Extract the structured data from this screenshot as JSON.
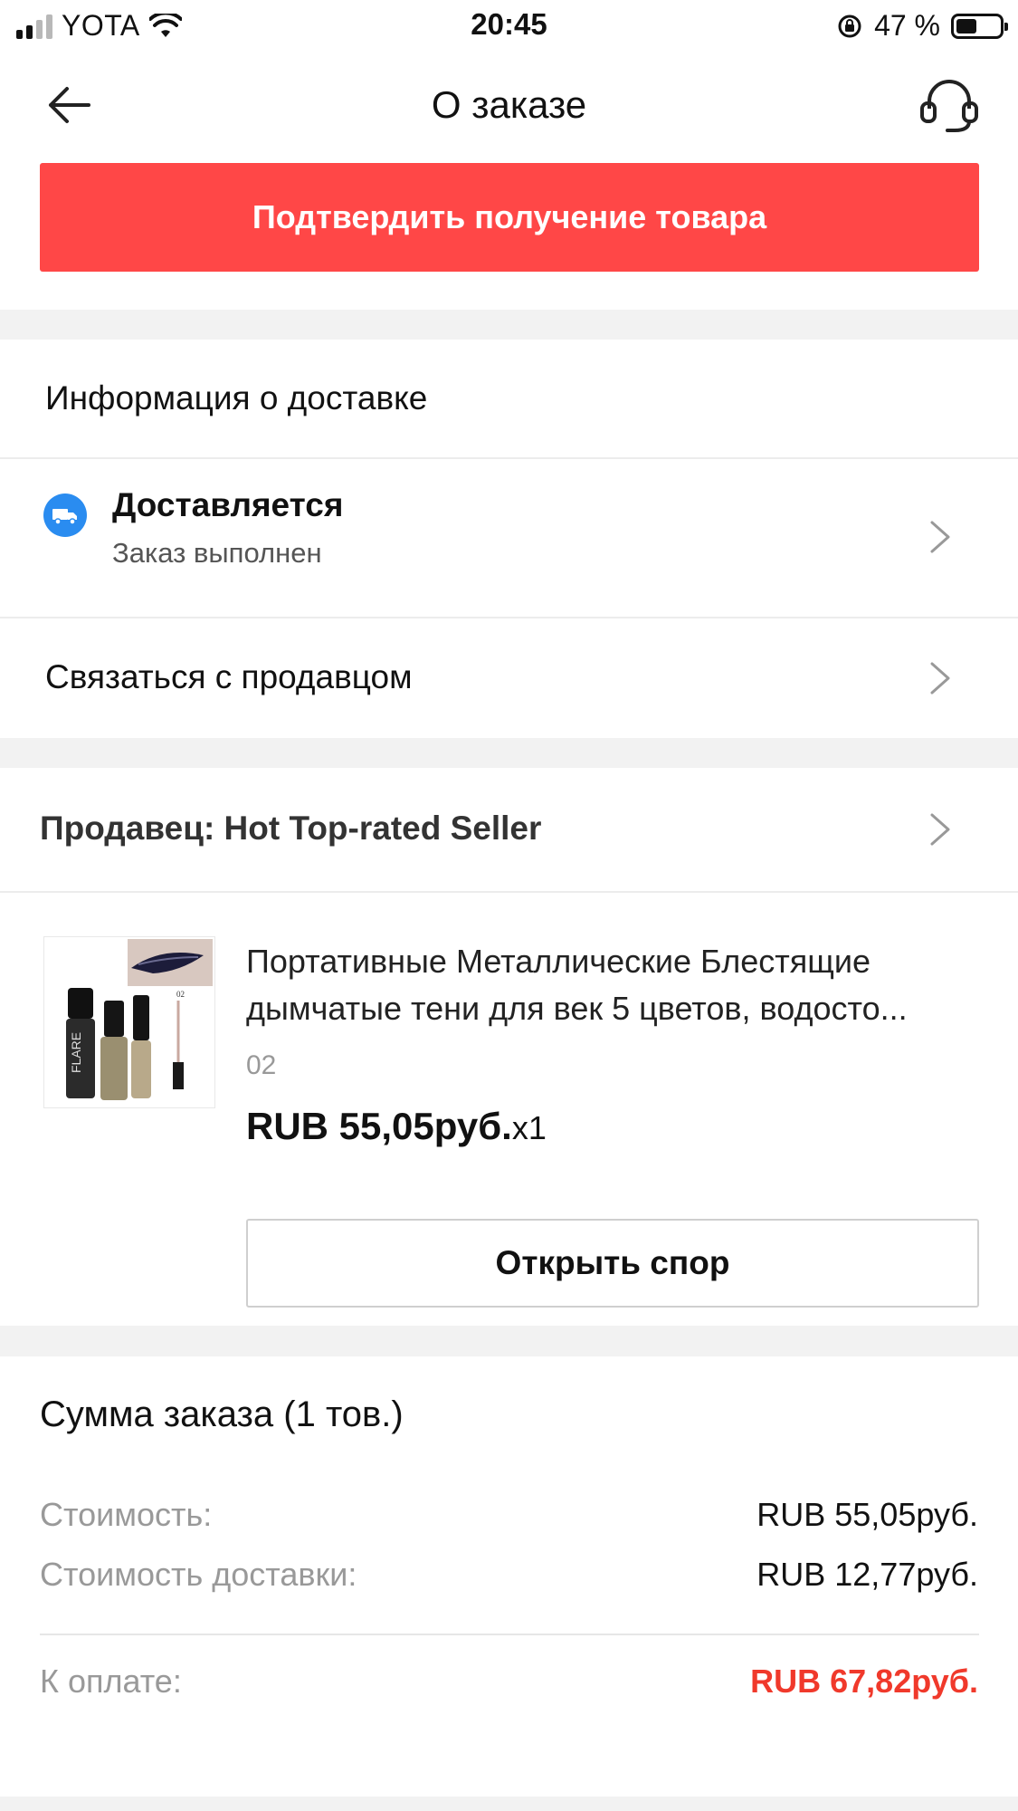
{
  "status_bar": {
    "carrier": "YOTA",
    "time": "20:45",
    "battery": "47 %",
    "battery_level": 0.47
  },
  "header": {
    "title": "О заказе"
  },
  "confirm": {
    "label": "Подтвердить получение товара",
    "color": "#ff4747"
  },
  "delivery": {
    "heading": "Информация о доставке",
    "status_title": "Доставляется",
    "status_subtitle": "Заказ выполнен",
    "contact_seller": "Связаться с продавцом"
  },
  "seller": {
    "label": "Продавец: Hot Top-rated Seller"
  },
  "product": {
    "title_line1": "Портативные Металлические Блестящие",
    "title_line2": "дымчатые тени для век 5 цветов, водосто...",
    "variant": "02",
    "price": "RUB 55,05руб.",
    "quantity": "x1",
    "thumb_brand": "FLARE",
    "thumb_code": "02",
    "dispute_label": "Открыть спор"
  },
  "summary": {
    "title": "Сумма заказа (1 тов.)",
    "cost_label": "Стоимость:",
    "cost_value": "RUB 55,05руб.",
    "shipping_label": "Стоимость доставки:",
    "shipping_value": "RUB 12,77руб.",
    "total_label": "К оплате:",
    "total_value": "RUB 67,82руб.",
    "total_color": "#f0392b"
  }
}
